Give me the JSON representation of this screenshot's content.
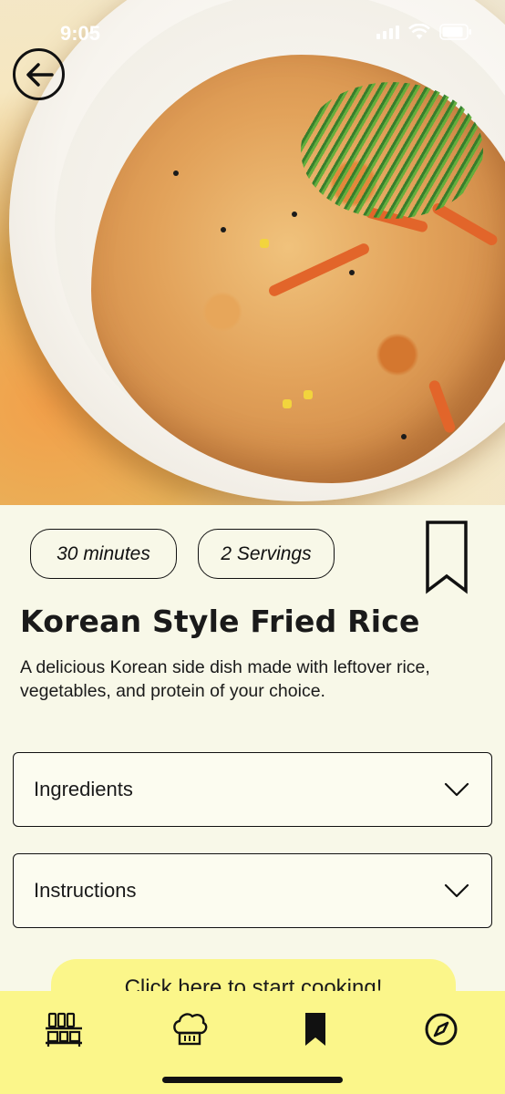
{
  "status_bar": {
    "time": "9:05"
  },
  "recipe": {
    "time_label": "30 minutes",
    "servings_label": "2 Servings",
    "title": "Korean Style Fried Rice",
    "description": "A delicious Korean side dish made with leftover rice, vegetables, and protein of your choice."
  },
  "sections": {
    "ingredients_label": "Ingredients",
    "instructions_label": "Instructions"
  },
  "cta": {
    "label": "Click here to start cooking!"
  },
  "tabbar": {
    "items": [
      {
        "icon": "pantry-shelf-icon"
      },
      {
        "icon": "chef-hat-icon"
      },
      {
        "icon": "bookmark-icon"
      },
      {
        "icon": "compass-icon"
      }
    ]
  },
  "colors": {
    "background": "#f8f8e8",
    "accent_yellow": "#fbf68a",
    "text": "#1a1a1a"
  }
}
